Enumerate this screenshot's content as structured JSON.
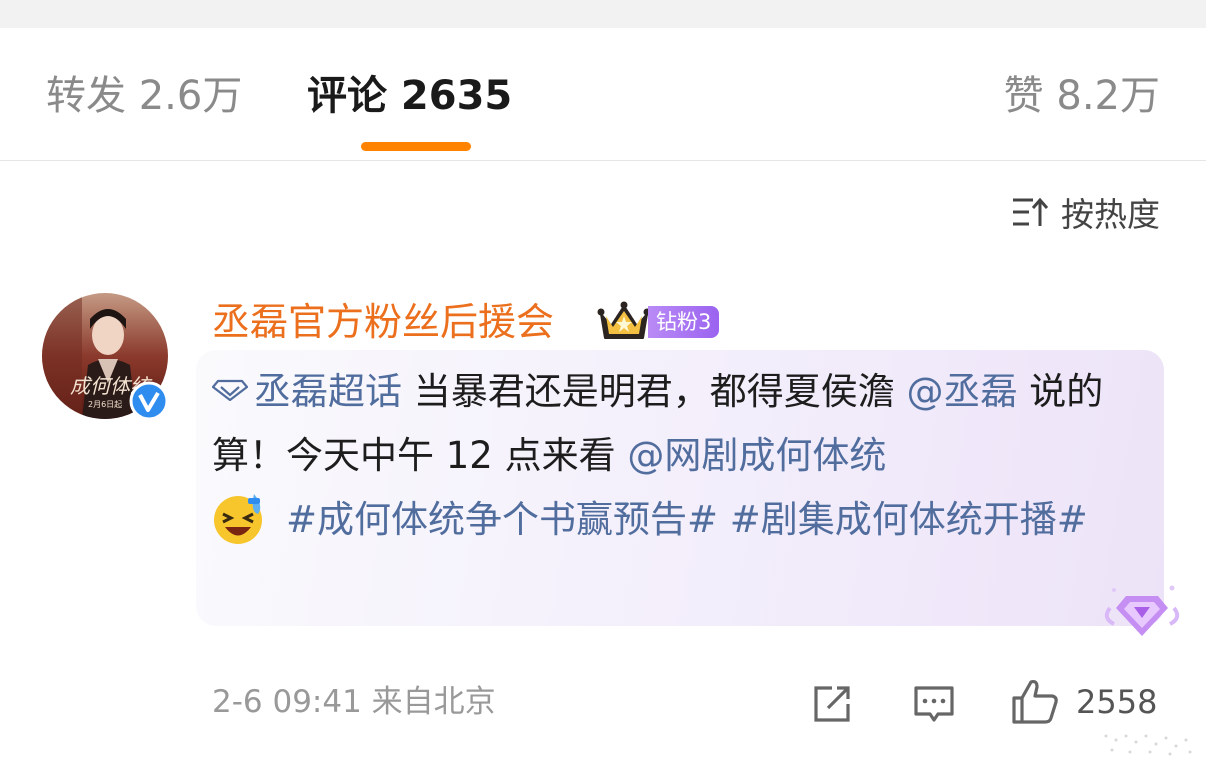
{
  "tabs": {
    "repost": "转发 2.6万",
    "comments": "评论 2635",
    "likes": "赞 8.2万",
    "accent_color": "#ff8200"
  },
  "sort": {
    "label": "按热度",
    "icon": "sort-icon"
  },
  "comment": {
    "username": "丞磊官方粉丝后援会",
    "username_color": "#eb6f1c",
    "fan_badge": "钻粉3",
    "verified": true,
    "avatar_caption": "2月6日起",
    "segments": {
      "supertopic": "丞磊超话",
      "text1": " 当暴君还是明君，都得夏侯澹 ",
      "mention1": "@丞磊",
      "text2": " 说的算！今天中午 12 点来看 ",
      "mention2": "@网剧成何体统",
      "hashtag1": "#成何体统争个书赢预告#",
      "hashtag2": "#剧集成何体统开播#"
    },
    "link_color": "#506d9e",
    "meta": "2-6 09:41 来自北京",
    "like_count": "2558"
  }
}
